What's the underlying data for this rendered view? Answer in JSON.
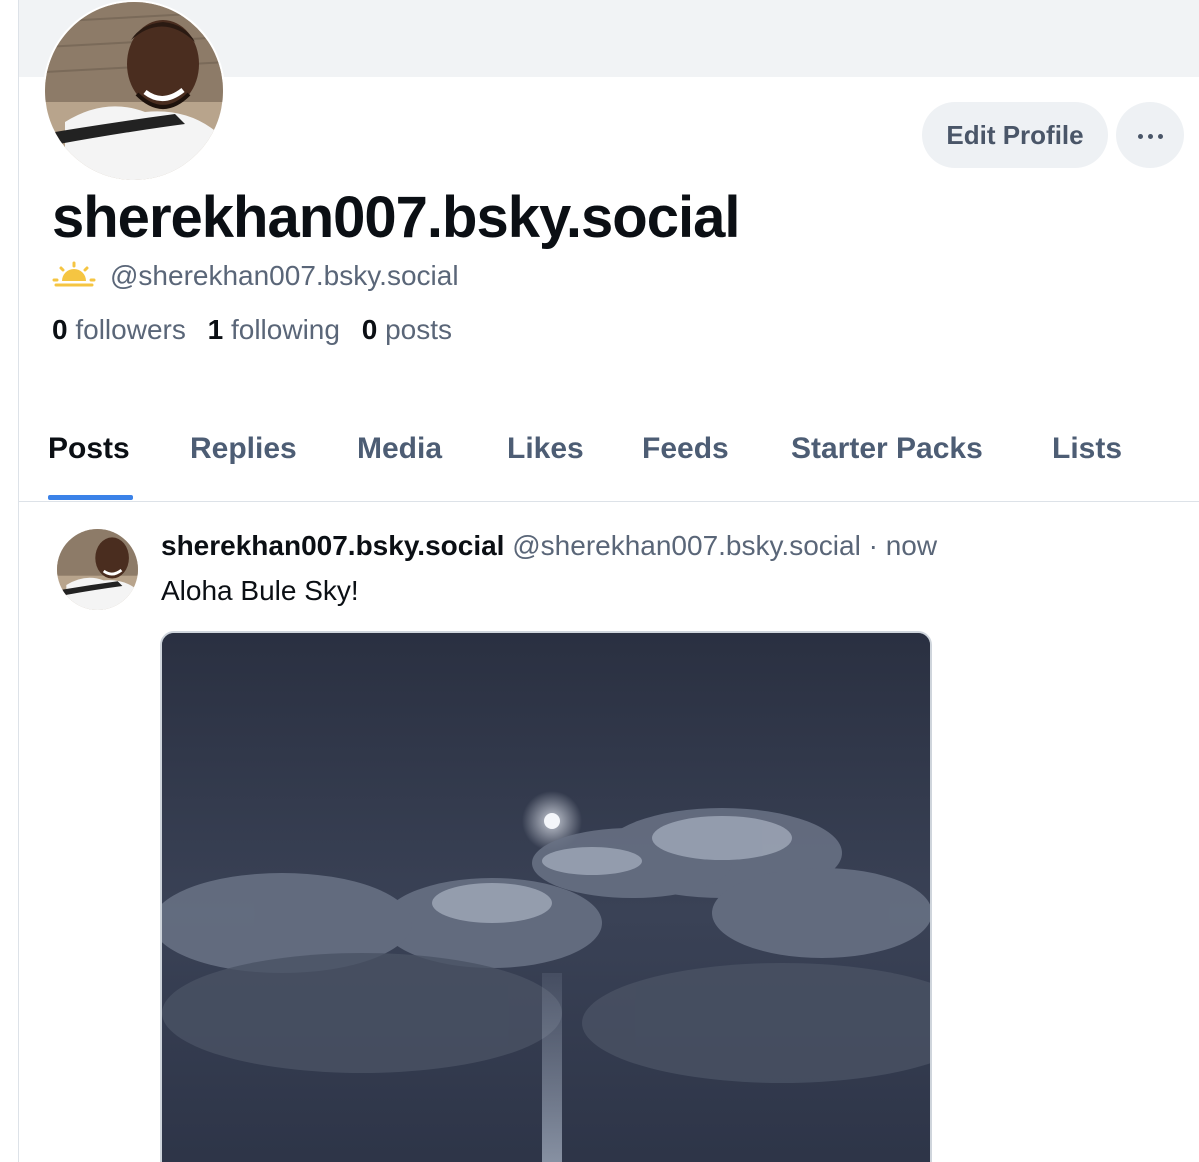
{
  "profile": {
    "display_name": "sherekhan007.bsky.social",
    "handle": "@sherekhan007.bsky.social",
    "handle_icon": "sun-weather-icon",
    "stats": {
      "followers_count": "0",
      "followers_label": "followers",
      "following_count": "1",
      "following_label": "following",
      "posts_count": "0",
      "posts_label": "posts"
    },
    "edit_profile_label": "Edit Profile",
    "more_icon": "ellipsis-icon"
  },
  "tabs": [
    {
      "label": "Posts",
      "active": true
    },
    {
      "label": "Replies",
      "active": false
    },
    {
      "label": "Media",
      "active": false
    },
    {
      "label": "Likes",
      "active": false
    },
    {
      "label": "Feeds",
      "active": false
    },
    {
      "label": "Starter Packs",
      "active": false
    },
    {
      "label": "Lists",
      "active": false
    }
  ],
  "post": {
    "author": "sherekhan007.bsky.social",
    "handle": "@sherekhan007.bsky.social",
    "separator": "·",
    "time": "now",
    "text": "Aloha Bule Sky!",
    "image_subject": "moon-clouds-night-sky-photo"
  },
  "colors": {
    "accent": "#3b82e8",
    "banner": "#f1f3f5",
    "button_bg": "#eef1f4",
    "muted_text": "#5a6678",
    "primary_text": "#0b0f14",
    "sun_icon": "#f5c542"
  }
}
